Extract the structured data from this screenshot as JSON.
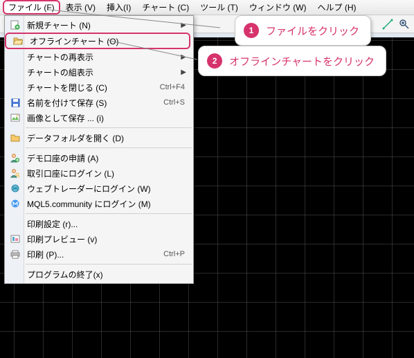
{
  "menubar": {
    "file": "ファイル (F)",
    "view": "表示 (V)",
    "insert": "挿入(I)",
    "chart": "チャート (C)",
    "tools": "ツール (T)",
    "window": "ウィンドウ (W)",
    "help": "ヘルプ (H)"
  },
  "dropdown": {
    "new_chart": "新規チャート (N)",
    "offline_chart": "オフラインチャート (O)",
    "chart_redisplay": "チャートの再表示",
    "chart_combine": "チャートの組表示",
    "close_chart": "チャートを閉じる (C)",
    "close_chart_sc": "Ctrl+F4",
    "save_as": "名前を付けて保存 (S)",
    "save_as_sc": "Ctrl+S",
    "save_image": "画像として保存 ... (i)",
    "open_data_folder": "データフォルダを開く (D)",
    "demo_account": "デモ口座の申請 (A)",
    "login_trade": "取引口座にログイン (L)",
    "login_web": "ウェブトレーダーにログイン (W)",
    "login_mql5": "MQL5.community にログイン (M)",
    "print_setup": "印刷設定 (r)...",
    "print_preview": "印刷プレビュー (v)",
    "print": "印刷 (P)...",
    "print_sc": "Ctrl+P",
    "exit": "プログラムの終了(x)"
  },
  "callouts": {
    "c1_num": "1",
    "c1_text": "ファイルをクリック",
    "c2_num": "2",
    "c2_text": "オフラインチャートをクリック"
  }
}
